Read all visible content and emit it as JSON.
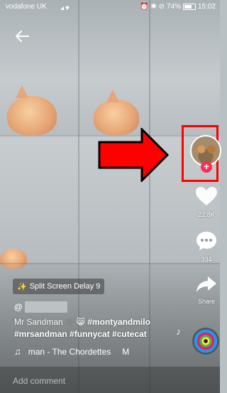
{
  "status_bar": {
    "carrier": "vodafone UK",
    "battery": "74%",
    "time": "15:02"
  },
  "effect_chip": {
    "label": "Split Screen Delay 9",
    "icon": "sparkle-icon"
  },
  "author": {
    "prefix": "@"
  },
  "caption": {
    "line1_text": "Mr Sandman",
    "line1_tag": "#montyandmilo",
    "line2": "#mrsandman #funnycat #cutecat"
  },
  "music": {
    "title": "man - The Chordettes",
    "trailing": "M"
  },
  "actions": {
    "like_count": "22.8K",
    "comment_count": "334",
    "share_label": "Share"
  },
  "comment_bar": {
    "placeholder": "Add comment"
  },
  "colors": {
    "annotation": "#ff0000",
    "follow_plus": "#fe2c55"
  }
}
